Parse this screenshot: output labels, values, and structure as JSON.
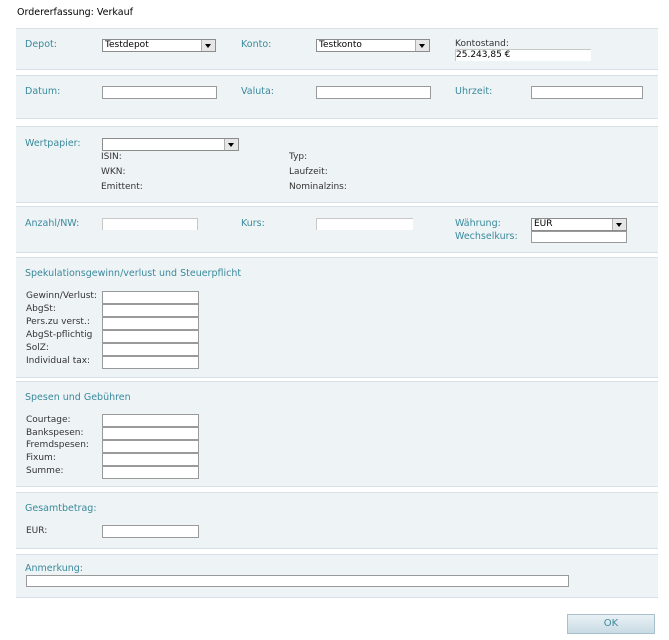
{
  "title": "Ordererfassung: Verkauf",
  "row1": {
    "depot_label": "Depot:",
    "depot_value": "Testdepot",
    "konto_label": "Konto:",
    "konto_value": "Testkonto",
    "kontostand_label": "Kontostand:",
    "kontostand_value": "25.243,85 €"
  },
  "row2": {
    "datum_label": "Datum:",
    "valuta_label": "Valuta:",
    "uhrzeit_label": "Uhrzeit:"
  },
  "wertpapier": {
    "label": "Wertpapier:",
    "value": "",
    "isin": "ISIN:",
    "wkn": "WKN:",
    "emittent": "Emittent:",
    "typ": "Typ:",
    "laufzeit": "Laufzeit:",
    "nominalzins": "Nominalzins:"
  },
  "row4": {
    "anzahl_label": "Anzahl/NW:",
    "kurs_label": "Kurs:",
    "waehrung_label": "Währung:",
    "waehrung_value": "EUR",
    "wechselkurs_label": "Wechselkurs:"
  },
  "spekulation": {
    "heading": "Spekulationsgewinn/verlust und Steuerpflicht",
    "fields": [
      "Gewinn/Verlust:",
      "AbgSt:",
      "Pers.zu verst.:",
      "AbgSt-pflichtig",
      "SolZ:",
      "Individual tax:"
    ]
  },
  "spesen": {
    "heading": "Spesen und Gebühren",
    "fields": [
      "Courtage:",
      "Bankspesen:",
      "Fremdspesen:",
      "Fixum:",
      "Summe:"
    ]
  },
  "gesamt": {
    "heading": "Gesamtbetrag:",
    "eur_label": "EUR:"
  },
  "anmerkung": {
    "label": "Anmerkung:"
  },
  "ok_label": "OK"
}
